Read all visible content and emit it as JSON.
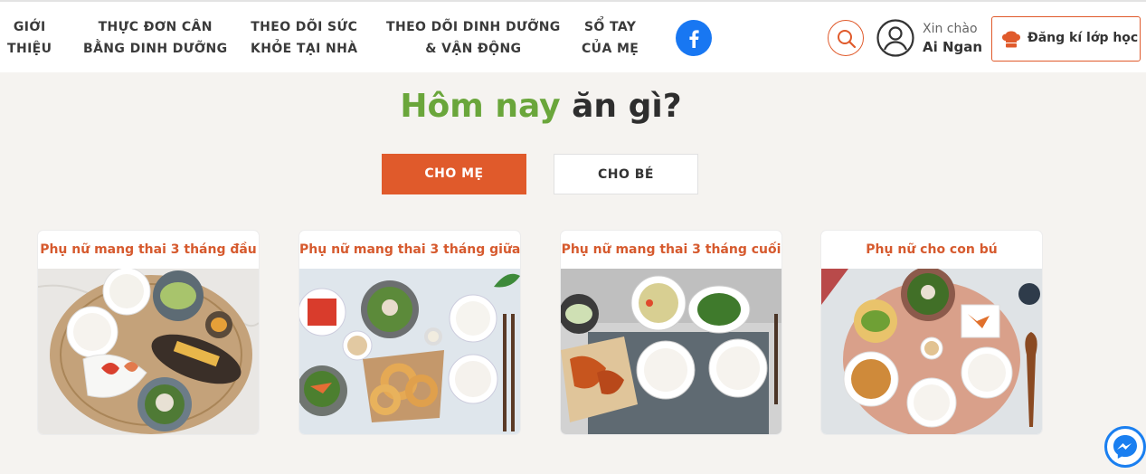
{
  "nav": [
    {
      "line1": "GIỚI",
      "line2": "THIỆU"
    },
    {
      "line1": "THỰC ĐƠN CÂN",
      "line2": "BẰNG DINH DƯỠNG"
    },
    {
      "line1": "THEO DÕI SỨC",
      "line2": "KHỎE TẠI NHÀ"
    },
    {
      "line1": "THEO DÕI DINH DƯỠNG",
      "line2": "& VẬN ĐỘNG"
    },
    {
      "line1": "SỔ TAY",
      "line2": "CỦA MẸ"
    }
  ],
  "user": {
    "greeting": "Xin chào",
    "name": "Ai Ngan"
  },
  "register_label": "Đăng kí lớp học",
  "hero": {
    "title_green": "Hôm nay",
    "title_dark": "ăn gì?"
  },
  "tabs": {
    "active": "CHO MẸ",
    "inactive": "CHO BÉ"
  },
  "cards": [
    {
      "title": "Phụ nữ mang thai 3 tháng đầu"
    },
    {
      "title": "Phụ nữ mang thai 3 tháng giữa"
    },
    {
      "title": "Phụ nữ mang thai 3 tháng cuối"
    },
    {
      "title": "Phụ nữ cho con bú"
    }
  ],
  "colors": {
    "accent": "#e05a2b",
    "green": "#6aa63b",
    "facebook": "#1877f2",
    "messenger": "#1a7ff0"
  },
  "icons": [
    "facebook-icon",
    "search-icon",
    "user-avatar-icon",
    "chef-hat-icon",
    "messenger-icon"
  ]
}
